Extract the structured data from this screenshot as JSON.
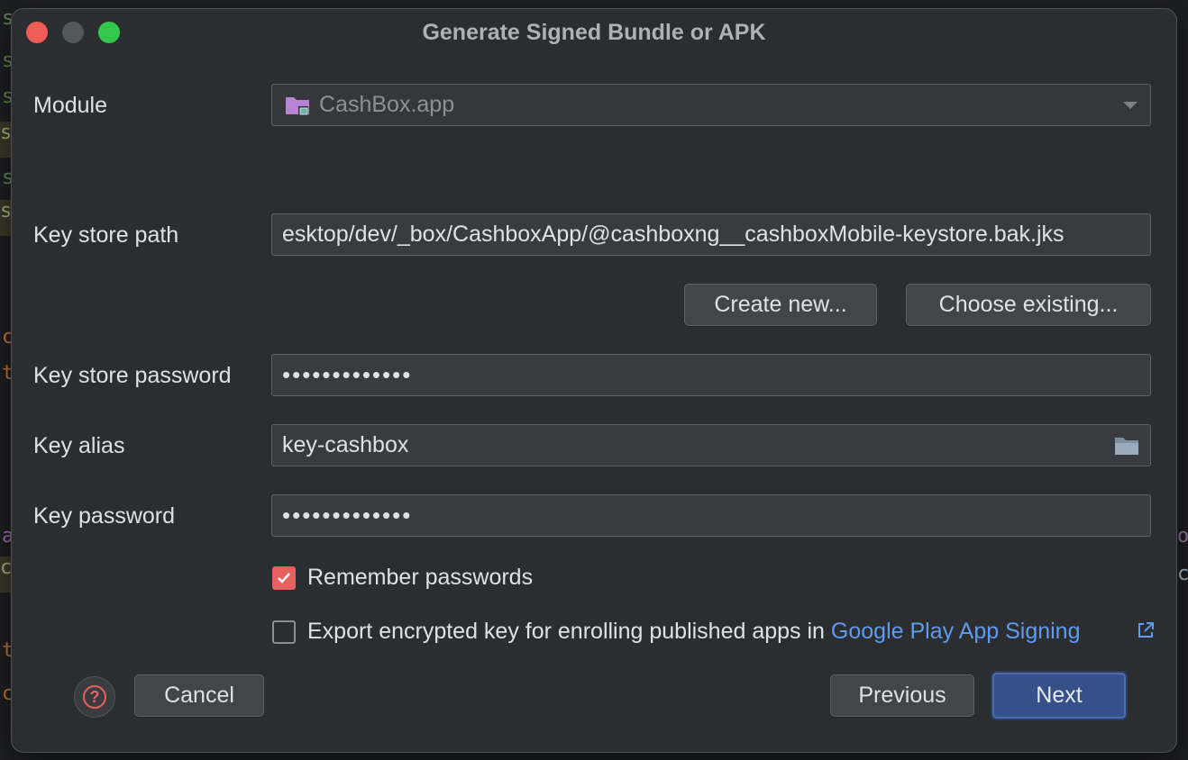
{
  "dialog": {
    "title": "Generate Signed Bundle or APK"
  },
  "module": {
    "label": "Module",
    "value": "CashBox.app",
    "icon": "module-folder-icon"
  },
  "keystore": {
    "path_label": "Key store path",
    "path_value": "esktop/dev/_box/CashboxApp/@cashboxng__cashboxMobile-keystore.bak.jks",
    "create_new": "Create new...",
    "choose_existing": "Choose existing...",
    "password_label": "Key store password",
    "password_value": "•••••••••••••"
  },
  "key": {
    "alias_label": "Key alias",
    "alias_value": "key-cashbox",
    "password_label": "Key password",
    "password_value": "•••••••••••••"
  },
  "options": {
    "remember_passwords": "Remember passwords",
    "remember_checked": true,
    "export_prefix": "Export encrypted key for enrolling published apps in",
    "export_link": "Google Play App Signing",
    "export_checked": false
  },
  "footer": {
    "help_glyph": "?",
    "cancel": "Cancel",
    "previous": "Previous",
    "next": "Next"
  },
  "colors": {
    "accent": "#365089",
    "checkbox_checked": "#e5605f",
    "link": "#5f9bee"
  }
}
